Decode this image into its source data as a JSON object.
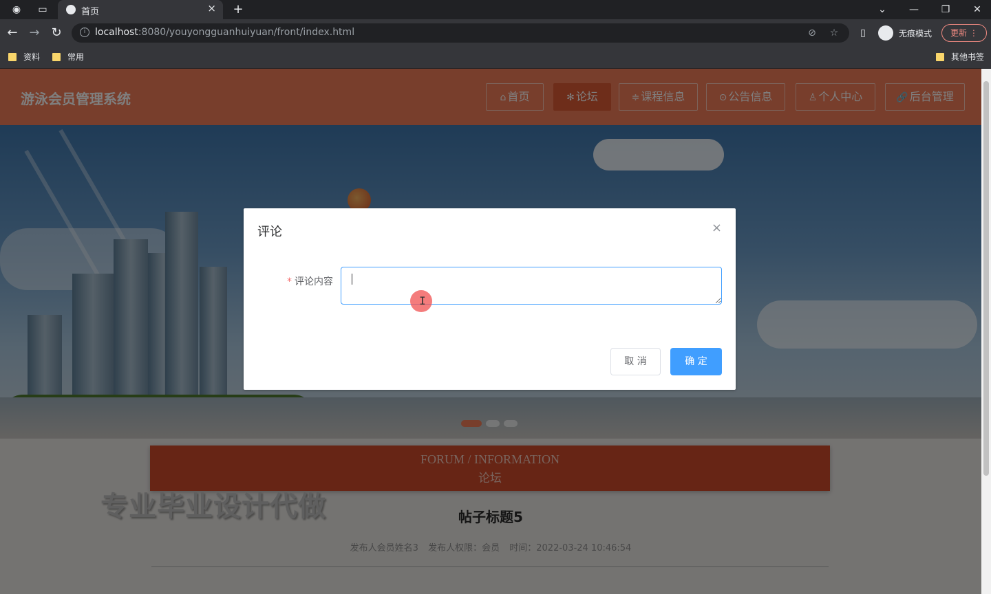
{
  "browser": {
    "tab_title": "首页",
    "url_host": "localhost",
    "url_path": ":8080/youyongguanhuiyuan/front/index.html",
    "incognito_label": "无痕模式",
    "update_label": "更新",
    "bookmarks": [
      "资料",
      "常用"
    ],
    "other_bookmarks": "其他书签",
    "tab_close": "×",
    "new_tab": "+",
    "win_min": "—",
    "win_restore": "❐",
    "win_close": "✕",
    "back": "←",
    "forward": "→",
    "reload": "↻",
    "tab_search": "⌄"
  },
  "site": {
    "title": "游泳会员管理系统",
    "nav": [
      {
        "icon": "⌂",
        "label": "首页"
      },
      {
        "icon": "✻",
        "label": "论坛"
      },
      {
        "icon": "≑",
        "label": "课程信息"
      },
      {
        "icon": "⊙",
        "label": "公告信息"
      },
      {
        "icon": "♙",
        "label": "个人中心"
      },
      {
        "icon": "🔗",
        "label": "后台管理"
      }
    ],
    "active_nav": "论坛",
    "accent_color": "#f07c58"
  },
  "section": {
    "en": "FORUM / INFORMATION",
    "cn": "论坛"
  },
  "watermark": "专业毕业设计代做",
  "post": {
    "title": "帖子标题5",
    "author": "发布人会员姓名3",
    "role": "发布人权限：会员",
    "time": "时间：2022-03-24 10:46:54"
  },
  "dialog": {
    "title": "评论",
    "close_icon": "×",
    "required_mark": "*",
    "field_label": "评论内容",
    "field_value": "",
    "cancel_label": "取 消",
    "confirm_label": "确 定",
    "primary_color": "#409eff"
  }
}
